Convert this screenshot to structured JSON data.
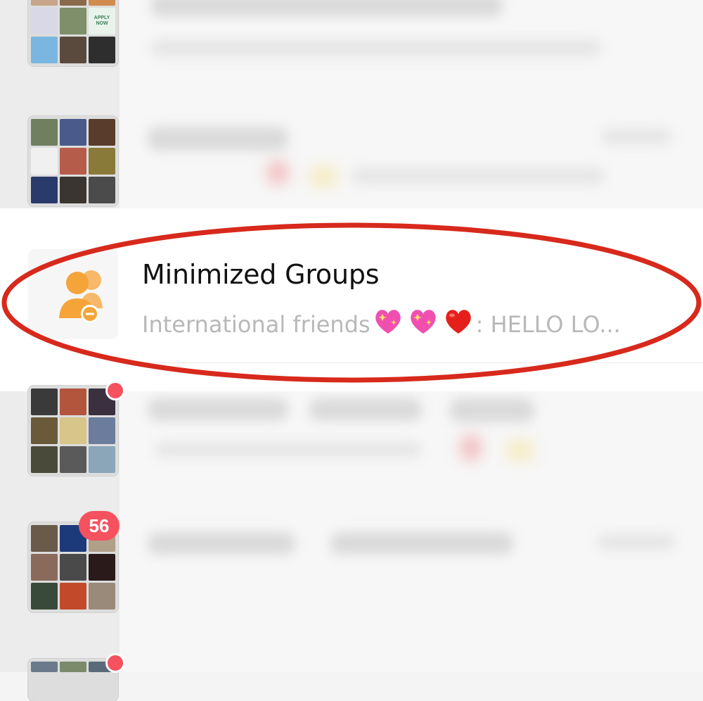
{
  "minimized_group": {
    "title": "Minimized Groups",
    "preview_sender": "International friends",
    "preview_emojis": [
      "sparkling-heart",
      "sparkling-heart",
      "red-heart"
    ],
    "preview_message": ": HELLO  LO..."
  },
  "apply_tile": {
    "text": "APPLY NOW"
  },
  "badges": {
    "unread_count": "56"
  },
  "colors": {
    "accent_orange": "#f5a43a",
    "badge_red": "#f5515f",
    "annotation_red": "#d7291c",
    "muted_text": "#b8b8b8"
  }
}
